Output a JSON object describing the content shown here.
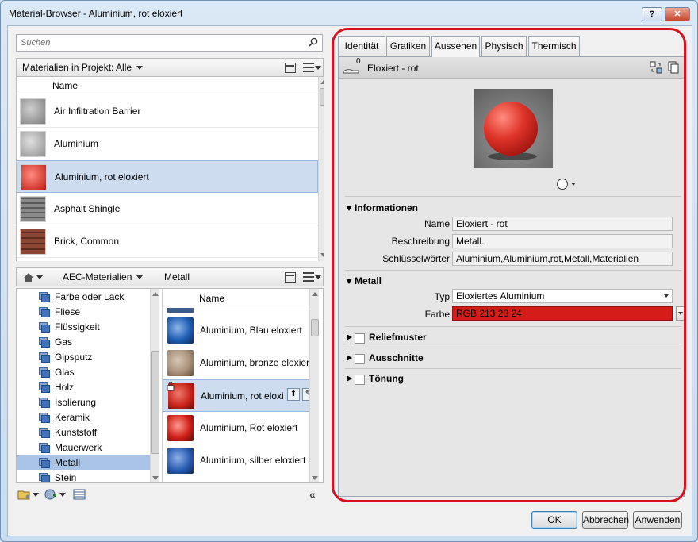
{
  "window": {
    "title": "Material-Browser - Aluminium, rot eloxiert",
    "help_label": "?",
    "close_label": "✕"
  },
  "search": {
    "placeholder": "Suchen"
  },
  "project": {
    "filter_label": "Materialien in Projekt: Alle",
    "column_header": "Name",
    "items": [
      {
        "label": "Air Infiltration Barrier",
        "swatch": "#8a8a8a"
      },
      {
        "label": "Aluminium",
        "swatch": "#9c9c9c"
      },
      {
        "label": "Aluminium, rot eloxiert",
        "swatch": "#d5281c",
        "selected": true
      },
      {
        "label": "Asphalt Shingle",
        "swatch": "#6e6e6e"
      },
      {
        "label": "Brick, Common",
        "swatch": "#7a3a2e"
      }
    ]
  },
  "library": {
    "breadcrumb": [
      "AEC-Materialien",
      "Metall"
    ],
    "column_header": "Name",
    "categories": [
      "Farbe oder Lack",
      "Fliese",
      "Flüssigkeit",
      "Gas",
      "Gipsputz",
      "Glas",
      "Holz",
      "Isolierung",
      "Keramik",
      "Kunststoff",
      "Mauerwerk",
      "Metall",
      "Stein"
    ],
    "selected_category": "Metall",
    "materials": [
      {
        "label": "Aluminium, Blau eloxiert",
        "color": "#1f5fb5"
      },
      {
        "label": "Aluminium, bronze eloxiert",
        "color": "#a9917a"
      },
      {
        "label": "Aluminium, rot eloxi",
        "color": "#c8231a",
        "selected": true
      },
      {
        "label": "Aluminium, Rot eloxiert",
        "color": "#d02018"
      },
      {
        "label": "Aluminium, silber eloxiert",
        "color": "#2a5db3"
      }
    ]
  },
  "editor": {
    "tabs": [
      "Identität",
      "Grafiken",
      "Aussehen",
      "Physisch",
      "Thermisch"
    ],
    "active_tab": "Aussehen",
    "asset_name": "Eloxiert - rot",
    "user_count": "0",
    "sections": {
      "info": "Informationen",
      "metal": "Metall",
      "relief": "Reliefmuster",
      "cutouts": "Ausschnitte",
      "tint": "Tönung"
    },
    "info_fields": {
      "name_label": "Name",
      "name_value": "Eloxiert - rot",
      "desc_label": "Beschreibung",
      "desc_value": "Metall.",
      "keywords_label": "Schlüsselwörter",
      "keywords_value": "Aluminium,Aluminium,rot,Metall,Materialien"
    },
    "metal_fields": {
      "type_label": "Typ",
      "type_value": "Eloxiertes Aluminium",
      "color_label": "Farbe",
      "color_value": "RGB 213 28 24",
      "color_hex": "#d51c18"
    }
  },
  "buttons": {
    "ok": "OK",
    "cancel": "Abbrechen",
    "apply": "Anwenden"
  },
  "accent": "#d6101c"
}
